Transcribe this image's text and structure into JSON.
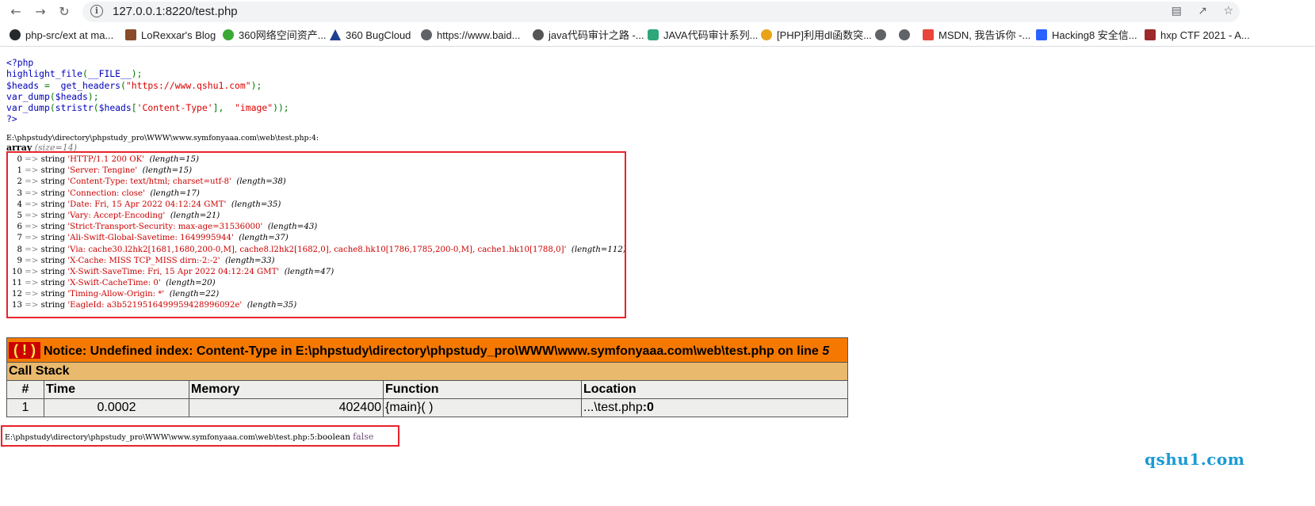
{
  "browser": {
    "back_icon": "back-arrow-icon",
    "forward_icon": "forward-arrow-icon",
    "reload_icon": "reload-icon",
    "url": "127.0.0.1:8220/test.php"
  },
  "bookmarks": [
    {
      "label": "php-src/ext at ma...",
      "color": "#24292e"
    },
    {
      "label": "LoRexxar's Blog",
      "color": "#8a4b2a"
    },
    {
      "label": "360网络空间资产...",
      "color": "#3ba935"
    },
    {
      "label": "360 BugCloud",
      "color": "#1d3f8f"
    },
    {
      "label": "https://www.baid...",
      "color": "#5f6368"
    },
    {
      "label": "java代码审计之路 -...",
      "color": "#555555"
    },
    {
      "label": "JAVA代码审计系列...",
      "color": "#2ea67a"
    },
    {
      "label": "[PHP]利用dl函数突...",
      "color": "#e8a317"
    },
    {
      "label": "",
      "color": "#5f6368"
    },
    {
      "label": "",
      "color": "#5f6368"
    },
    {
      "label": "MSDN, 我告诉你 -...",
      "color": "#e8453c"
    },
    {
      "label": "Hacking8 安全信...",
      "color": "#2962ff"
    },
    {
      "label": "hxp CTF 2021 - A...",
      "color": "#9c2a2a"
    }
  ],
  "code": {
    "line1": "<?php",
    "line2a": "highlight_file",
    "line2b": "(",
    "line2c": "__FILE__",
    "line2d": ");",
    "line3a": "$heads ",
    "line3b": "= ",
    "line3c": "get_headers",
    "line3d": "(",
    "line3e": "\"https://www.qshu1.com\"",
    "line3f": ");",
    "line4a": "var_dump",
    "line4b": "(",
    "line4c": "$heads",
    "line4d": ");",
    "line5a": "var_dump",
    "line5b": "(",
    "line5c": "stristr",
    "line5d": "(",
    "line5e": "$heads",
    "line5f": "[",
    "line5g": "'Content-Type'",
    "line5h": "], ",
    "line5i": "\"image\"",
    "line5j": "));",
    "line6": "?>"
  },
  "dump": {
    "path": "E:\\phpstudy\\directory\\phpstudy_pro\\WWW\\www.symfonyaaa.com\\web\\test.php:4:",
    "array_label": "array",
    "array_size": "(size=14)",
    "rows": [
      {
        "k": "0",
        "v": "'HTTP/1.1 200 OK'",
        "l": "(length=15)"
      },
      {
        "k": "1",
        "v": "'Server: Tengine'",
        "l": "(length=15)"
      },
      {
        "k": "2",
        "v": "'Content-Type: text/html; charset=utf-8'",
        "l": "(length=38)"
      },
      {
        "k": "3",
        "v": "'Connection: close'",
        "l": "(length=17)"
      },
      {
        "k": "4",
        "v": "'Date: Fri, 15 Apr 2022 04:12:24 GMT'",
        "l": "(length=35)"
      },
      {
        "k": "5",
        "v": "'Vary: Accept-Encoding'",
        "l": "(length=21)"
      },
      {
        "k": "6",
        "v": "'Strict-Transport-Security: max-age=31536000'",
        "l": "(length=43)"
      },
      {
        "k": "7",
        "v": "'Ali-Swift-Global-Savetime: 1649995944'",
        "l": "(length=37)"
      },
      {
        "k": "8",
        "v": "'Via: cache30.l2hk2[1681,1680,200-0,M], cache8.l2hk2[1682,0], cache8.hk10[1786,1785,200-0,M], cache1.hk10[1788,0]'",
        "l": "(length=112)"
      },
      {
        "k": "9",
        "v": "'X-Cache: MISS TCP_MISS dirn:-2:-2'",
        "l": "(length=33)"
      },
      {
        "k": "10",
        "v": "'X-Swift-SaveTime: Fri, 15 Apr 2022 04:12:24 GMT'",
        "l": "(length=47)"
      },
      {
        "k": "11",
        "v": "'X-Swift-CacheTime: 0'",
        "l": "(length=20)"
      },
      {
        "k": "12",
        "v": "'Timing-Allow-Origin: *'",
        "l": "(length=22)"
      },
      {
        "k": "13",
        "v": "'EagleId: a3b5219516499959428996092e'",
        "l": "(length=35)"
      }
    ],
    "type_word": "string",
    "arrow": "=>"
  },
  "xdebug": {
    "bang": "( ! )",
    "notice": "Notice: Undefined index: Content-Type in E:\\phpstudy\\directory\\phpstudy_pro\\WWW\\www.symfonyaaa.com\\web\\test.php on line ",
    "line_no": "5",
    "call_stack": "Call Stack",
    "headers": [
      "#",
      "Time",
      "Memory",
      "Function",
      "Location"
    ],
    "row": {
      "num": "1",
      "time": "0.0002",
      "memory": "402400",
      "function": "{main}( )",
      "location_a": "...\\test.php",
      "location_b": ":0"
    }
  },
  "result": {
    "path": "E:\\phpstudy\\directory\\phpstudy_pro\\WWW\\www.symfonyaaa.com\\web\\test.php:5:",
    "type": "boolean",
    "value": "false"
  },
  "watermark": "qshu1.com"
}
